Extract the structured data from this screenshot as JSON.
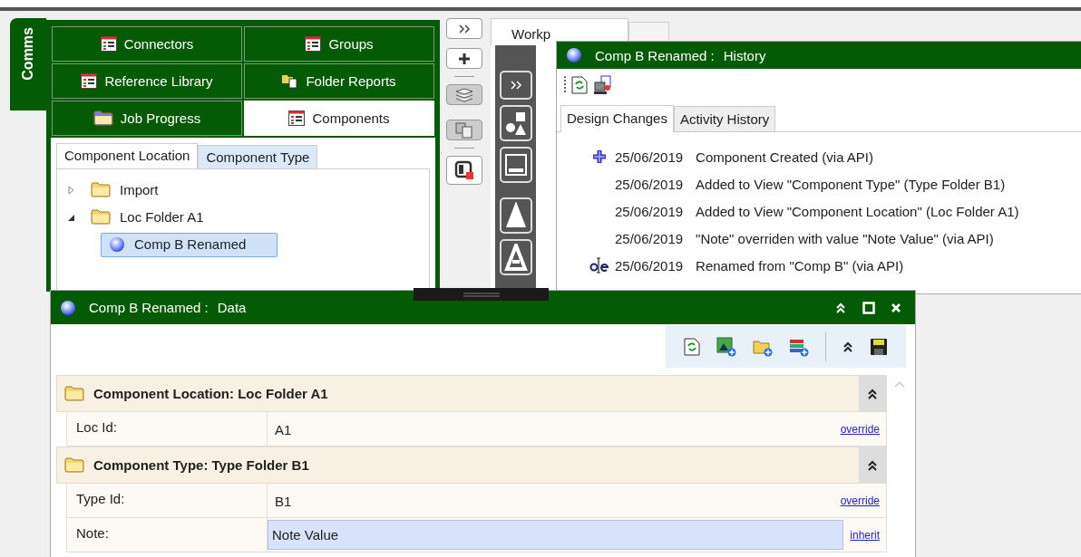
{
  "side_tab": {
    "label": "Comms",
    "selected": true
  },
  "panel_tabs": [
    [
      {
        "label": "Connectors",
        "selected": false
      },
      {
        "label": "Groups",
        "selected": false
      }
    ],
    [
      {
        "label": "Reference Library",
        "selected": false
      },
      {
        "label": "Folder Reports",
        "selected": false
      }
    ],
    [
      {
        "label": "Job Progress",
        "selected": false
      },
      {
        "label": "Components",
        "selected": true
      }
    ]
  ],
  "view_tabs": [
    {
      "label": "Component Location",
      "selected": true
    },
    {
      "label": "Component Type",
      "selected": false
    }
  ],
  "tree": [
    {
      "label": "Import",
      "expanded": false,
      "selected": false
    },
    {
      "label": "Loc Folder A1",
      "expanded": true,
      "selected": false,
      "children": [
        {
          "label": "Comp B Renamed",
          "selected": true
        }
      ]
    }
  ],
  "workspace_tab": {
    "label": "Workp"
  },
  "history_window": {
    "title": "Comp B Renamed :",
    "subtitle": "History",
    "tabs": [
      {
        "label": "Design Changes",
        "selected": true
      },
      {
        "label": "Activity History",
        "selected": false
      }
    ],
    "entries": [
      {
        "kind": "created",
        "date": "25/06/2019",
        "text": "Component Created (via API)"
      },
      {
        "kind": "plain",
        "date": "25/06/2019",
        "text": "Added to View \"Component Type\" (Type Folder B1)"
      },
      {
        "kind": "plain",
        "date": "25/06/2019",
        "text": "Added to View \"Component Location\" (Loc Folder A1)"
      },
      {
        "kind": "plain",
        "date": "25/06/2019",
        "text": "\"Note\" overriden with value \"Note Value\" (via API)"
      },
      {
        "kind": "renamed",
        "date": "25/06/2019",
        "text": "Renamed from \"Comp B\" (via API)"
      }
    ]
  },
  "data_window": {
    "title": "Comp B Renamed :",
    "subtitle": "Data",
    "sections": [
      {
        "title": "Component Location: Loc Folder A1",
        "fields": [
          {
            "kind": "text",
            "label": "Loc Id:",
            "value": "A1",
            "action": "override"
          }
        ]
      },
      {
        "title": "Component Type: Type Folder B1",
        "fields": [
          {
            "kind": "text",
            "label": "Type Id:",
            "value": "B1",
            "action": "override"
          },
          {
            "kind": "input",
            "label": "Note:",
            "value": "Note Value",
            "action": "inherit"
          }
        ]
      }
    ]
  }
}
